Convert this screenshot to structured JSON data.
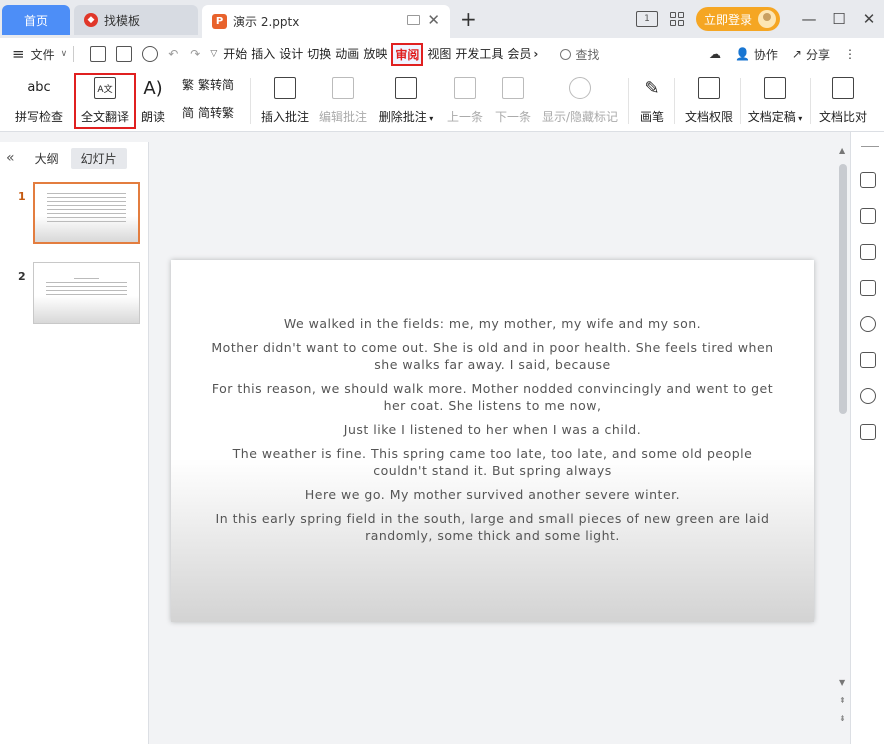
{
  "titlebar": {
    "home_tab": "首页",
    "template_tab": "找模板",
    "doc_tab": "演示 2.pptx",
    "login": "立即登录"
  },
  "menubar": {
    "file": "文件",
    "tabs": [
      "开始",
      "插入",
      "设计",
      "切换",
      "动画",
      "放映",
      "审阅",
      "视图",
      "开发工具",
      "会员"
    ],
    "active_tab": "审阅",
    "search": "查找",
    "collab": "协作",
    "share": "分享"
  },
  "ribbon": {
    "spell_check": "拼写检查",
    "translate": "全文翻译",
    "read_aloud": "朗读",
    "trad": "繁转简",
    "simp": "简转繁",
    "insert_comment": "插入批注",
    "edit_comment": "编辑批注",
    "delete_comment": "删除批注",
    "prev": "上一条",
    "next": "下一条",
    "show_hide": "显示/隐藏标记",
    "pen": "画笔",
    "doc_perm": "文档权限",
    "doc_final": "文档定稿",
    "doc_compare": "文档比对",
    "spell_icon_text": "abc",
    "translate_icon_text": "A文"
  },
  "left_panel": {
    "outline_tab": "大纲",
    "slides_tab": "幻灯片",
    "slide_numbers": [
      "1",
      "2"
    ]
  },
  "slide": {
    "paragraphs": [
      "We walked in the fields: me, my mother, my wife and my son.",
      "Mother didn't want to come out. She is old and in poor health. She feels tired when she walks far away. I said, because",
      "For this reason, we should walk more. Mother nodded convincingly and went to get her coat. She listens to me now,",
      "Just like I listened to her when I was a child.",
      "The weather is fine. This spring came too late, too late, and some old people couldn't stand it. But spring always",
      "Here we go. My mother survived another severe winter.",
      "In this early spring field in the south, large and small pieces of new green are laid randomly, some thick and some light."
    ]
  }
}
